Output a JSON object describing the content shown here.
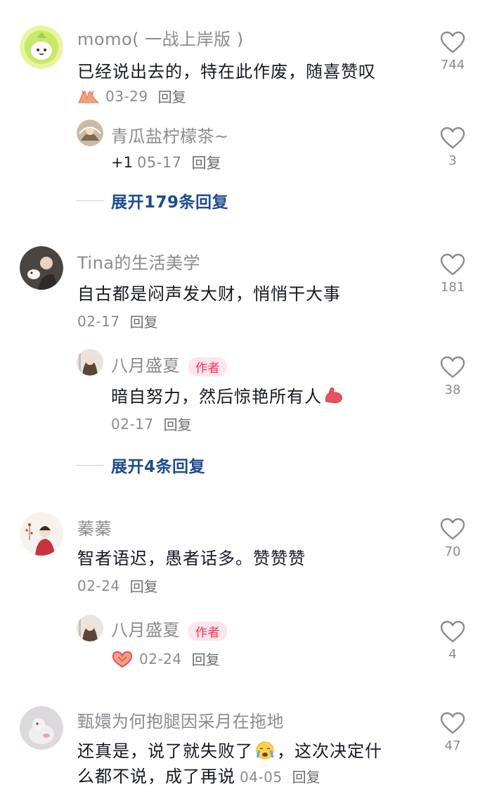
{
  "comments": [
    {
      "username": "momo( 一战上岸版 )",
      "text": "已经说出去的，特在此作废，随喜赞叹",
      "date": "03-29",
      "reply_label": "回复",
      "likes": "744",
      "emoji": "hands-emoji",
      "replies": [
        {
          "username": "青瓜盐柠檬茶~",
          "text": "+1",
          "date": "05-17",
          "reply_label": "回复",
          "likes": "3"
        }
      ],
      "expand_label": "展开179条回复"
    },
    {
      "username": "Tina的生活美学",
      "text": "自古都是闷声发大财，悄悄干大事",
      "date": "02-17",
      "reply_label": "回复",
      "likes": "181",
      "replies": [
        {
          "username": "八月盛夏",
          "badge": "作者",
          "text": "暗自努力，然后惊艳所有人",
          "date": "02-17",
          "reply_label": "回复",
          "likes": "38",
          "emoji": "muscle-emoji"
        }
      ],
      "expand_label": "展开4条回复"
    },
    {
      "username": "蓁蓁",
      "text": "智者语迟，愚者话多。赞赞赞",
      "date": "02-24",
      "reply_label": "回复",
      "likes": "70",
      "replies": [
        {
          "username": "八月盛夏",
          "badge": "作者",
          "text": "",
          "date": "02-24",
          "reply_label": "回复",
          "likes": "4",
          "emoji": "heart-hands-emoji"
        }
      ]
    },
    {
      "username": "甄嬛为何抱腿因采月在拖地",
      "text_line1": "还真是，说了就失败了",
      "text_line1b": "，这次决定什",
      "text_line2": "么都不说，成了再说",
      "date": "04-05",
      "reply_label": "回复",
      "likes": "47",
      "emoji": "crying-emoji"
    }
  ],
  "colors": {
    "username": "#8a8b91",
    "text": "#161823",
    "expand": "#1e4b8f",
    "badge_text": "#fe2c55",
    "badge_bg": "#ffe6ea"
  }
}
